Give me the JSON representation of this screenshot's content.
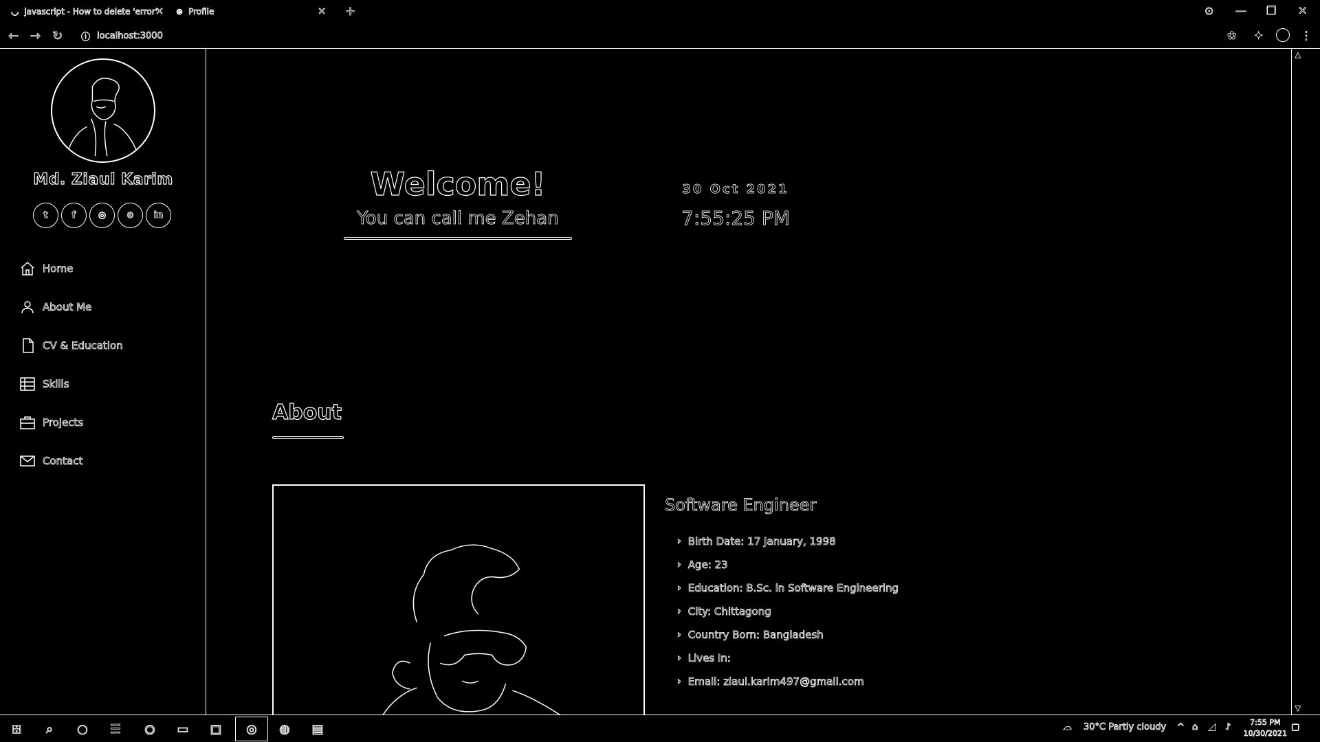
{
  "browser": {
    "tabs": [
      {
        "title": "javascript - How to delete 'error'",
        "active": false
      },
      {
        "title": "Profile",
        "active": true
      }
    ],
    "url": "localhost:3000"
  },
  "sidebar": {
    "name": "Md. Ziaul Karim",
    "socials": [
      {
        "icon": "twitter-icon",
        "glyph": "t"
      },
      {
        "icon": "facebook-icon",
        "glyph": "f"
      },
      {
        "icon": "instagram-icon",
        "glyph": "◎"
      },
      {
        "icon": "github-icon",
        "glyph": "⊙"
      },
      {
        "icon": "linkedin-icon",
        "glyph": "in"
      }
    ],
    "nav": [
      {
        "label": "Home",
        "icon": "home-icon"
      },
      {
        "label": "About Me",
        "icon": "user-icon"
      },
      {
        "label": "CV & Education",
        "icon": "document-icon"
      },
      {
        "label": "Skills",
        "icon": "list-icon"
      },
      {
        "label": "Projects",
        "icon": "briefcase-icon"
      },
      {
        "label": "Contact",
        "icon": "mail-icon"
      }
    ]
  },
  "hero": {
    "welcome": "Welcome!",
    "callme": "You can call me Zehan",
    "date": "30 Oct 2021",
    "time": "7:55:25 PM"
  },
  "about": {
    "heading": "About",
    "role": "Software Engineer",
    "facts": [
      "Birth Date: 17 January, 1998",
      "Age: 23",
      "Education: B.Sc. in Software Engineering",
      "City: Chittagong",
      "Country Born: Bangladesh",
      "Lives In:",
      "Email: ziaul.karim497@gmail.com"
    ]
  },
  "taskbar": {
    "weather": "30°C  Partly cloudy",
    "time": "7:55 PM",
    "date": "10/30/2021"
  }
}
